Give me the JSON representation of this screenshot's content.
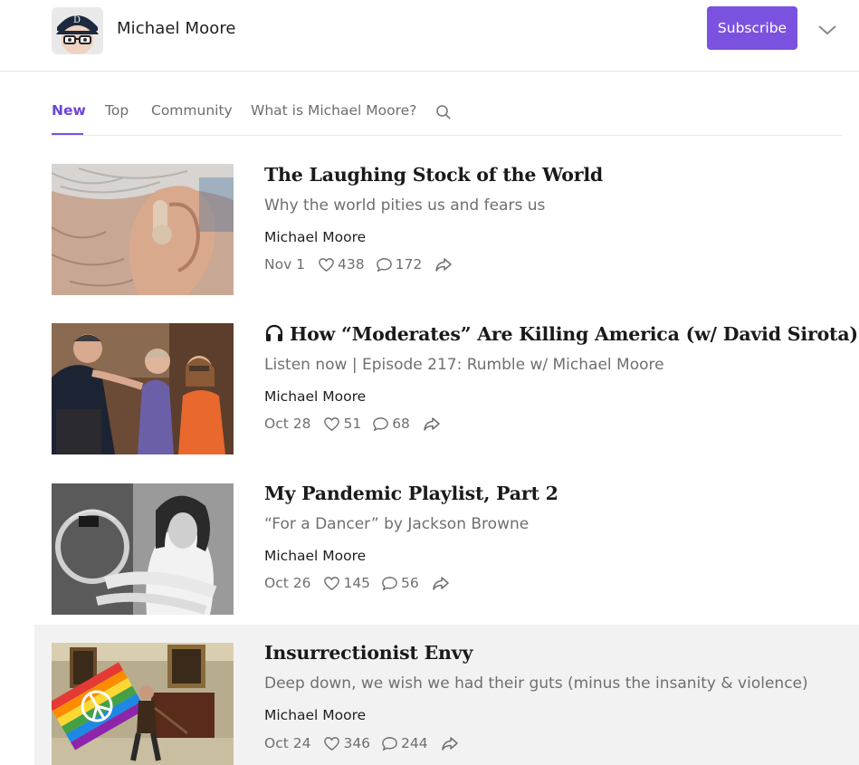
{
  "header": {
    "publication_name": "Michael Moore",
    "subscribe_label": "Subscribe"
  },
  "tabs": [
    {
      "label": "New",
      "active": true
    },
    {
      "label": "Top",
      "active": false
    },
    {
      "label": "Community",
      "active": false
    },
    {
      "label": "What is Michael Moore?",
      "active": false
    }
  ],
  "colors": {
    "accent": "#7b52e0",
    "highlight_row": "#f2f2f2",
    "muted_text": "#6f6f6f"
  },
  "posts": [
    {
      "title": "The Laughing Stock of the World",
      "subtitle": "Why the world pities us and fears us",
      "author": "Michael Moore",
      "date": "Nov 1",
      "likes": "438",
      "comments": "172",
      "podcast": false
    },
    {
      "title": "How “Moderates” Are Killing America (w/ David Sirota)",
      "subtitle": "Listen now | Episode 217: Rumble w/ Michael Moore",
      "author": "Michael Moore",
      "date": "Oct 28",
      "likes": "51",
      "comments": "68",
      "podcast": true
    },
    {
      "title": "My Pandemic Playlist, Part 2",
      "subtitle": "“For a Dancer” by Jackson Browne",
      "author": "Michael Moore",
      "date": "Oct 26",
      "likes": "145",
      "comments": "56",
      "podcast": false
    },
    {
      "title": "Insurrectionist Envy",
      "subtitle": "Deep down, we wish we had their guts (minus the insanity & violence)",
      "author": "Michael Moore",
      "date": "Oct 24",
      "likes": "346",
      "comments": "244",
      "podcast": false
    }
  ]
}
